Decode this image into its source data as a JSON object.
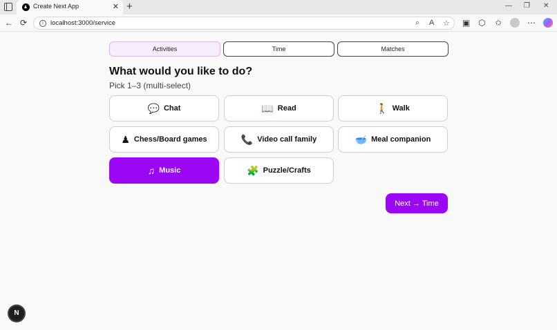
{
  "browser": {
    "tab_title": "Create Next App",
    "tab_close": "✕",
    "new_tab": "+",
    "url": "localhost:3000/service",
    "window_controls": [
      "—",
      "❐",
      "✕"
    ]
  },
  "nav_tabs": [
    {
      "label": "Activities",
      "active": true
    },
    {
      "label": "Time",
      "active": false
    },
    {
      "label": "Matches",
      "active": false
    }
  ],
  "heading": "What would you like to do?",
  "subheading": "Pick 1–3 (multi-select)",
  "options": [
    {
      "label": "Chat",
      "icon": "speech-bubble-icon",
      "glyph": "💬",
      "selected": false
    },
    {
      "label": "Read",
      "icon": "book-icon",
      "glyph": "📖",
      "selected": false
    },
    {
      "label": "Walk",
      "icon": "person-walking-icon",
      "glyph": "🚶",
      "selected": false
    },
    {
      "label": "Chess/Board games",
      "icon": "chess-pawn-icon",
      "glyph": "♟",
      "selected": false
    },
    {
      "label": "Video call family",
      "icon": "telephone-icon",
      "glyph": "📞",
      "selected": false
    },
    {
      "label": "Meal companion",
      "icon": "bowl-icon",
      "glyph": "🥣",
      "selected": false
    },
    {
      "label": "Music",
      "icon": "music-note-icon",
      "glyph": "♫",
      "selected": true
    },
    {
      "label": "Puzzle/Crafts",
      "icon": "puzzle-piece-icon",
      "glyph": "🧩",
      "selected": false
    }
  ],
  "next_button": "Next → Time",
  "next_badge": "N",
  "colors": {
    "accent": "#9b06f5",
    "active_tab_bg": "#f7ecfd"
  }
}
